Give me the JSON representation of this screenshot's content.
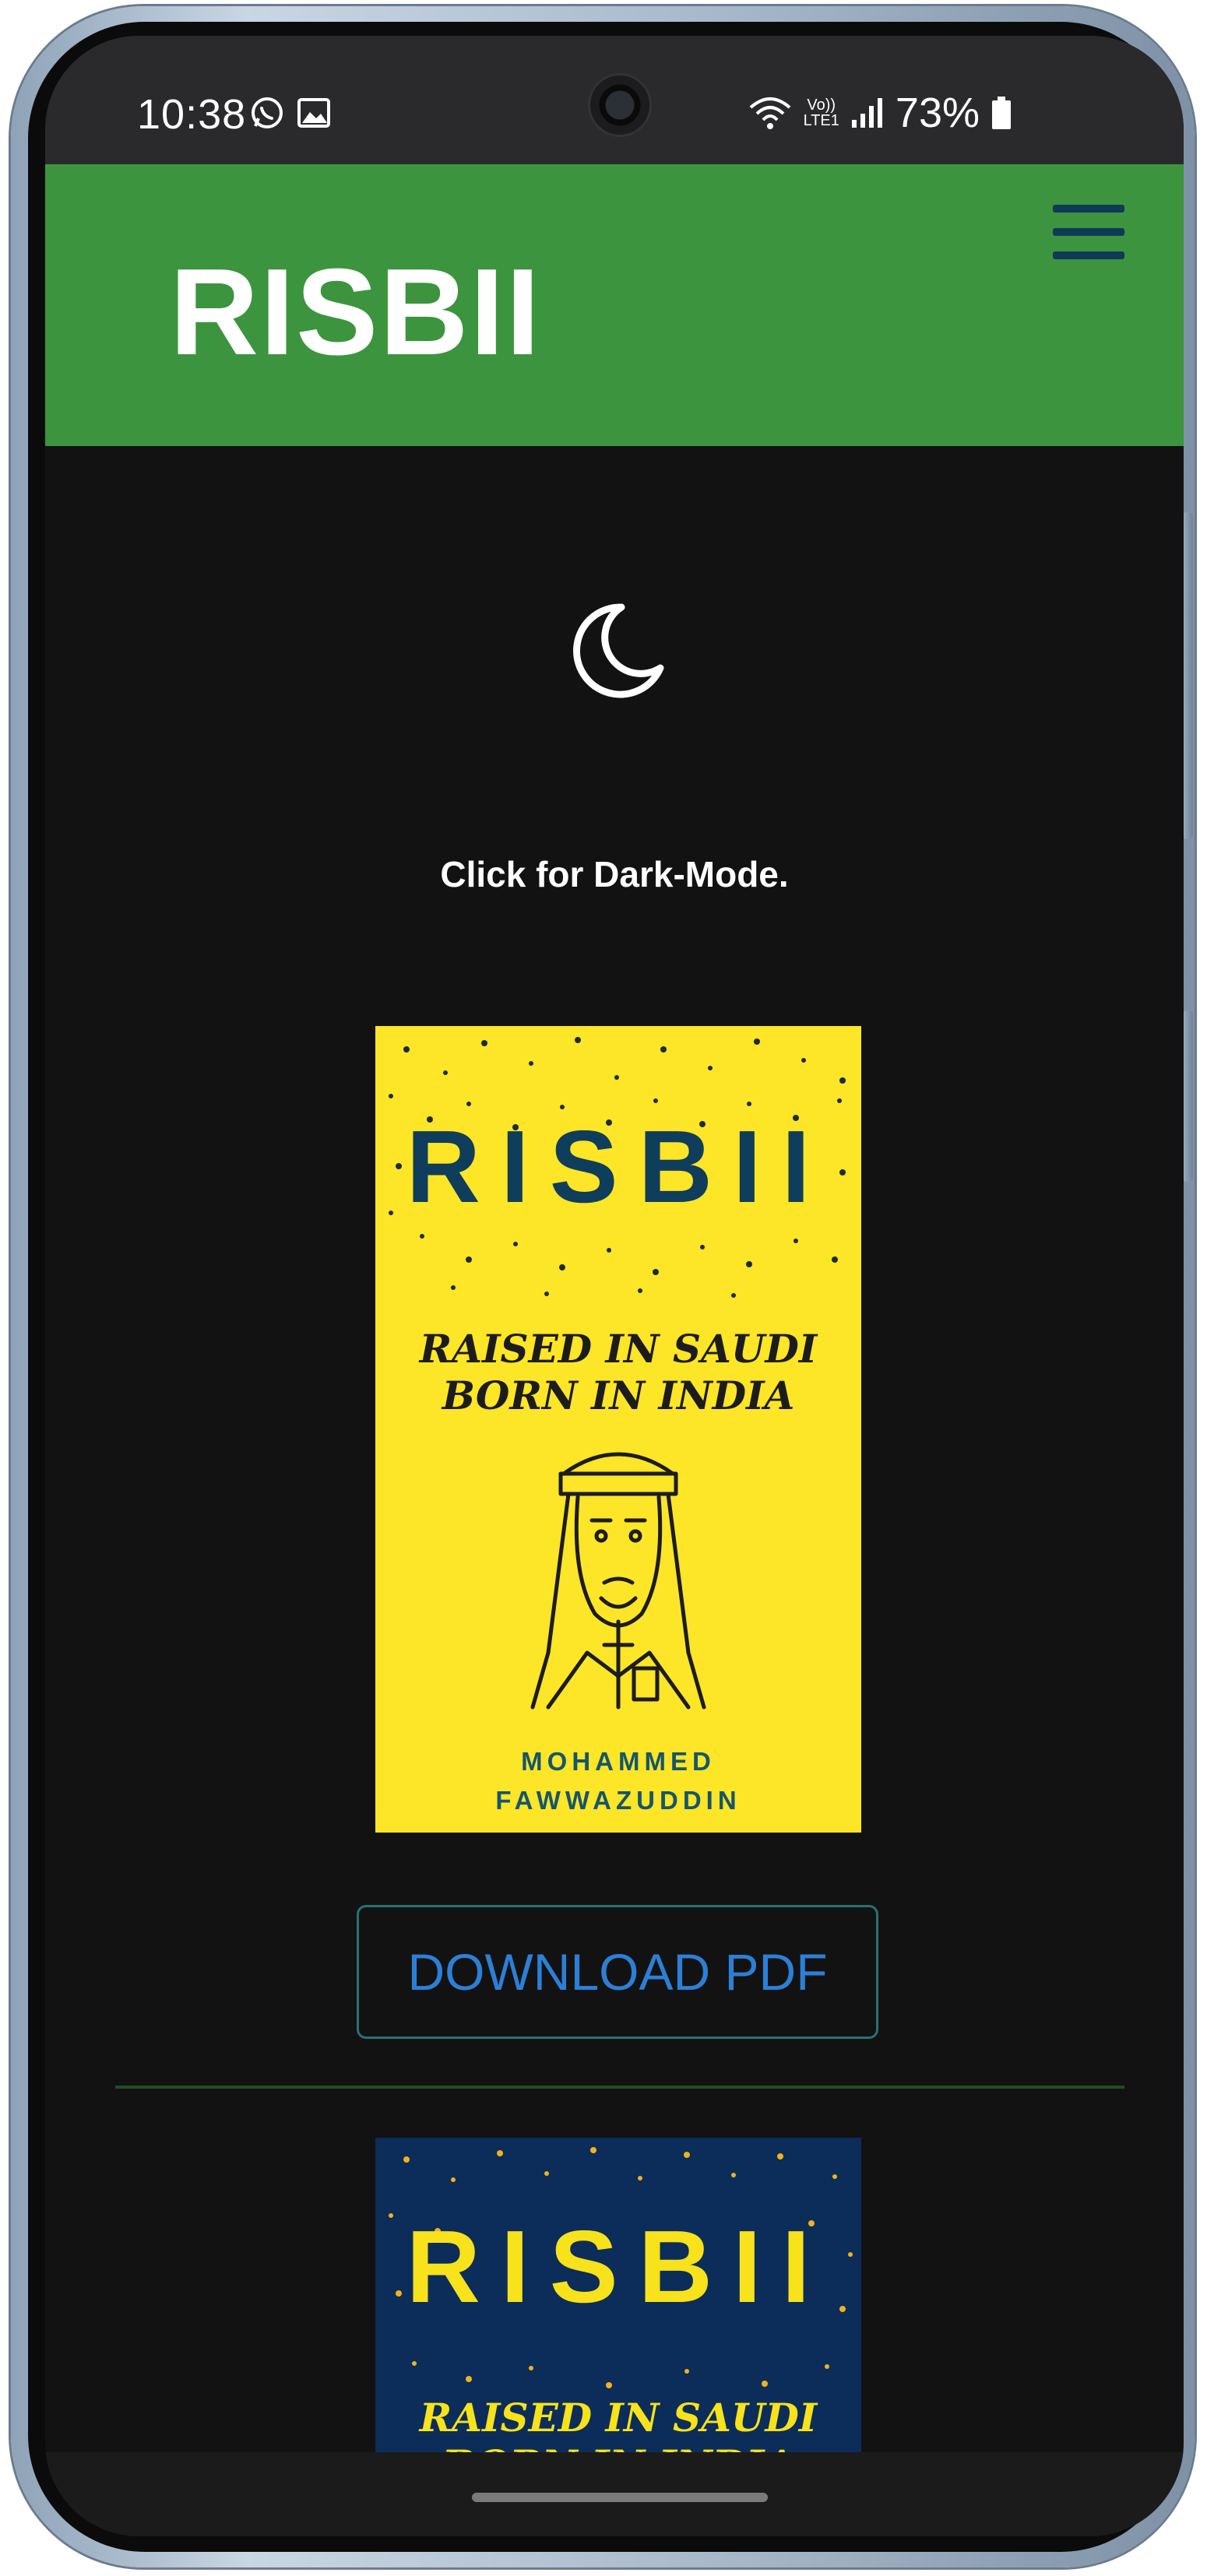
{
  "status_bar": {
    "time": "10:38",
    "volte_top": "Vo))",
    "volte_bottom": "LTE1",
    "battery": "73%"
  },
  "header": {
    "brand": "RISBII",
    "menu_icon": "hamburger-icon"
  },
  "dark_mode": {
    "icon": "moon-icon",
    "label": "Click for Dark-Mode."
  },
  "books": [
    {
      "title": "RISBII",
      "subtitle_line1": "RAISED IN SAUDI",
      "subtitle_line2": "BORN IN INDIA",
      "author_line1": "MOHAMMED",
      "author_line2": "FAWWAZUDDIN",
      "download_label": "DOWNLOAD PDF",
      "cover_color": "#fde528",
      "text_color": "#0f3d5c"
    },
    {
      "title": "RISBII",
      "subtitle_line1": "RAISED IN SAUDI",
      "subtitle_line2": "BORN IN INDIA",
      "cover_color": "#0c2d5a",
      "text_color": "#f7e21b"
    }
  ],
  "colors": {
    "header_green": "#3c953e",
    "page_background": "#121212",
    "link_blue": "#2c7fd6",
    "hamburger": "#0f3b57"
  }
}
